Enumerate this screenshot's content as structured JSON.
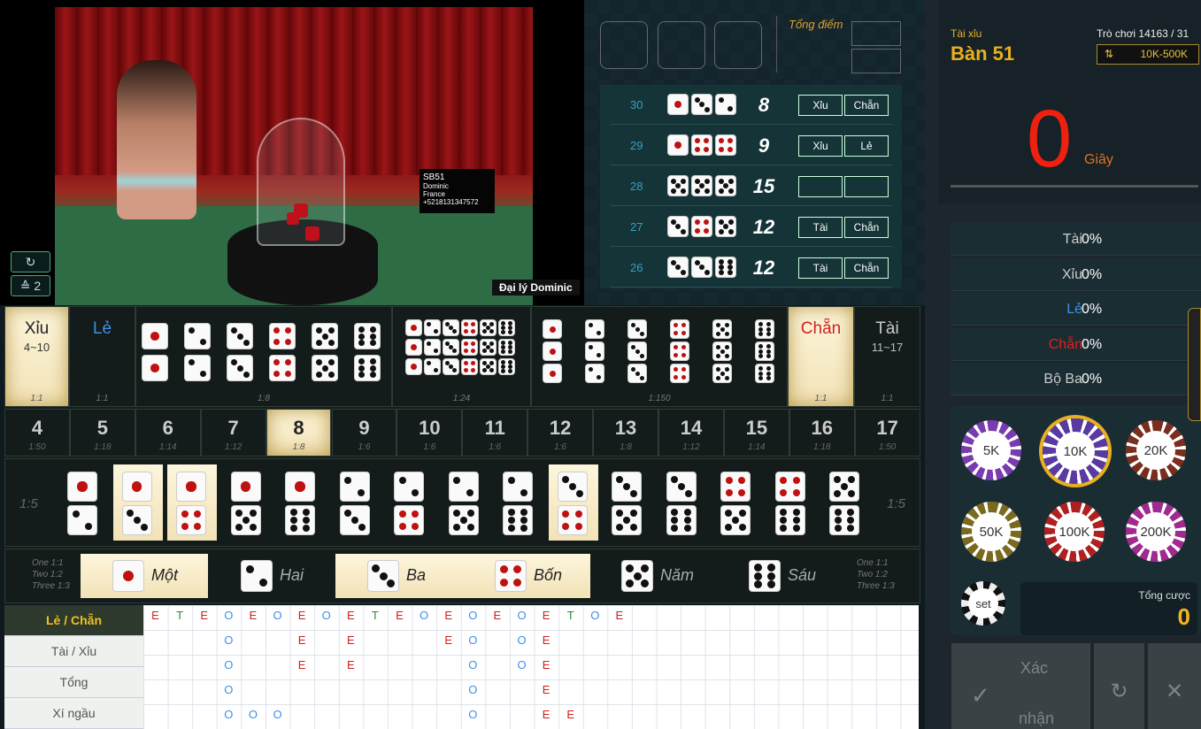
{
  "video": {
    "sign_lines": [
      "SB51",
      "Dominic",
      "France",
      "+5218131347572"
    ],
    "agent_label": "Đại lý Dominic",
    "refresh_icon": "refresh-icon",
    "signal_icon": "wifi-icon",
    "signal_value": "2"
  },
  "history": {
    "total_label": "Tổng điểm",
    "rows": [
      {
        "round": "30",
        "dice": [
          1,
          3,
          2
        ],
        "sum": "8",
        "b1": "Xỉu",
        "b2": "Chẵn"
      },
      {
        "round": "29",
        "dice": [
          1,
          4,
          4
        ],
        "sum": "9",
        "b1": "Xỉu",
        "b2": "Lẻ"
      },
      {
        "round": "28",
        "dice": [
          5,
          5,
          5
        ],
        "sum": "15",
        "b1": "",
        "b2": ""
      },
      {
        "round": "27",
        "dice": [
          3,
          4,
          5
        ],
        "sum": "12",
        "b1": "Tài",
        "b2": "Chẵn"
      },
      {
        "round": "26",
        "dice": [
          3,
          3,
          6
        ],
        "sum": "12",
        "b1": "Tài",
        "b2": "Chẵn"
      }
    ]
  },
  "header": {
    "game": "Tài xỉu",
    "table": "Bàn 51",
    "round": "Trò chơi 14163 / 31",
    "limit": "10K-500K"
  },
  "timer": {
    "value": "0",
    "unit": "Giây"
  },
  "stats": [
    {
      "label": "Tài",
      "value": "0%",
      "color": "#cccccc"
    },
    {
      "label": "Xỉu",
      "value": "0%",
      "color": "#cccccc"
    },
    {
      "label": "Lẻ",
      "value": "0%",
      "color": "#3f8fe8"
    },
    {
      "label": "Chẵn",
      "value": "0%",
      "color": "#e02020"
    },
    {
      "label": "Bộ Ba",
      "value": "0%",
      "color": "#cccccc"
    }
  ],
  "chips": [
    {
      "label": "5K",
      "color": "#7a3ab0"
    },
    {
      "label": "10K",
      "color": "#5a3aa0",
      "selected": true
    },
    {
      "label": "20K",
      "color": "#7a2e1e"
    },
    {
      "label": "50K",
      "color": "#7a6a20"
    },
    {
      "label": "100K",
      "color": "#b02020"
    },
    {
      "label": "200K",
      "color": "#a02a90"
    }
  ],
  "set_label": "set",
  "bet_total": {
    "label": "Tổng cược",
    "value": "0"
  },
  "actions": {
    "confirm_line1": "Xác",
    "confirm_line2": "nhận",
    "refresh": "refresh-icon",
    "close": "close-icon"
  },
  "board": {
    "xiu": {
      "label": "Xỉu",
      "range": "4~10",
      "odds": "1:1"
    },
    "le": {
      "label": "Lẻ",
      "odds": "1:1"
    },
    "pairs_odds": "1:8",
    "any_triple_odds": "1:24",
    "triples_odds": "1:150",
    "chan": {
      "label": "Chẵn",
      "odds": "1:1"
    },
    "tai": {
      "label": "Tài",
      "range": "11~17",
      "odds": "1:1"
    },
    "totals": [
      {
        "n": "4",
        "o": "1:50"
      },
      {
        "n": "5",
        "o": "1:18"
      },
      {
        "n": "6",
        "o": "1:14"
      },
      {
        "n": "7",
        "o": "1:12"
      },
      {
        "n": "8",
        "o": "1:8"
      },
      {
        "n": "9",
        "o": "1:6"
      },
      {
        "n": "10",
        "o": "1:6"
      },
      {
        "n": "11",
        "o": "1:6"
      },
      {
        "n": "12",
        "o": "1:6"
      },
      {
        "n": "13",
        "o": "1:8"
      },
      {
        "n": "14",
        "o": "1:12"
      },
      {
        "n": "15",
        "o": "1:14"
      },
      {
        "n": "16",
        "o": "1:18"
      },
      {
        "n": "17",
        "o": "1:50"
      }
    ],
    "combo_odds_left": "1:5",
    "combo_odds_right": "1:5",
    "combos": [
      [
        1,
        2
      ],
      [
        1,
        3
      ],
      [
        1,
        4
      ],
      [
        1,
        5
      ],
      [
        1,
        6
      ],
      [
        2,
        3
      ],
      [
        2,
        4
      ],
      [
        2,
        5
      ],
      [
        2,
        6
      ],
      [
        3,
        4
      ],
      [
        3,
        5
      ],
      [
        3,
        6
      ],
      [
        4,
        5
      ],
      [
        4,
        6
      ],
      [
        5,
        6
      ]
    ],
    "single_odds": [
      "One 1:1",
      "Two 1:2",
      "Three 1:3"
    ],
    "singles": [
      "Một",
      "Hai",
      "Ba",
      "Bốn",
      "Năm",
      "Sáu"
    ]
  },
  "roadmap": {
    "labels": [
      "Lẻ / Chẵn",
      "Tài / Xỉu",
      "Tổng",
      "Xí ngầu"
    ],
    "rows": [
      [
        "E",
        "T",
        "E",
        "O",
        "E",
        "O",
        "E",
        "O",
        "E",
        "T",
        "E",
        "O",
        "E",
        "O",
        "E",
        "O",
        "E",
        "T",
        "O",
        "E"
      ],
      [
        "",
        "",
        "",
        "O",
        "",
        "",
        "E",
        "",
        "E",
        "",
        "",
        "",
        "E",
        "O",
        "",
        "O",
        "E",
        "",
        "",
        ""
      ],
      [
        "",
        "",
        "",
        "O",
        "",
        "",
        "E",
        "",
        "E",
        "",
        "",
        "",
        "",
        "O",
        "",
        "O",
        "E",
        "",
        "",
        ""
      ],
      [
        "",
        "",
        "",
        "O",
        "",
        "",
        "",
        "",
        "",
        "",
        "",
        "",
        "",
        "O",
        "",
        "",
        "E",
        "",
        "",
        ""
      ],
      [
        "",
        "",
        "",
        "O",
        "O",
        "O",
        "",
        "",
        "",
        "",
        "",
        "",
        "",
        "O",
        "",
        "",
        "E",
        "E",
        "",
        ""
      ]
    ]
  }
}
